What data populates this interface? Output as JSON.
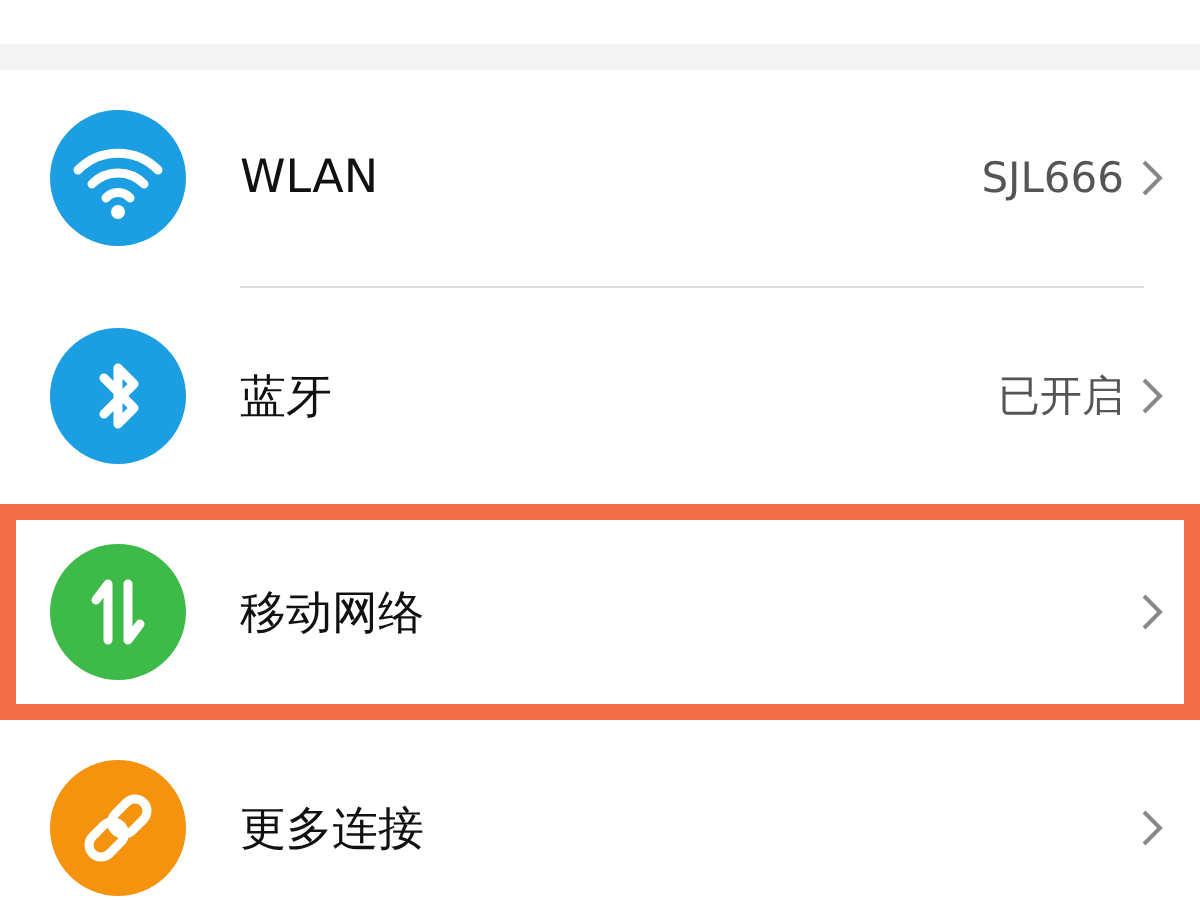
{
  "items": [
    {
      "kind": "wifi",
      "color": "#1b9ee2",
      "label": "WLAN",
      "value": "SJL666",
      "highlighted": false
    },
    {
      "kind": "bluetooth",
      "color": "#1b9ee2",
      "label": "蓝牙",
      "value": "已开启",
      "highlighted": false
    },
    {
      "kind": "data",
      "color": "#3dba48",
      "label": "移动网络",
      "highlighted": true
    },
    {
      "kind": "link",
      "color": "#f5930f",
      "label": "更多连接",
      "highlighted": false
    }
  ]
}
